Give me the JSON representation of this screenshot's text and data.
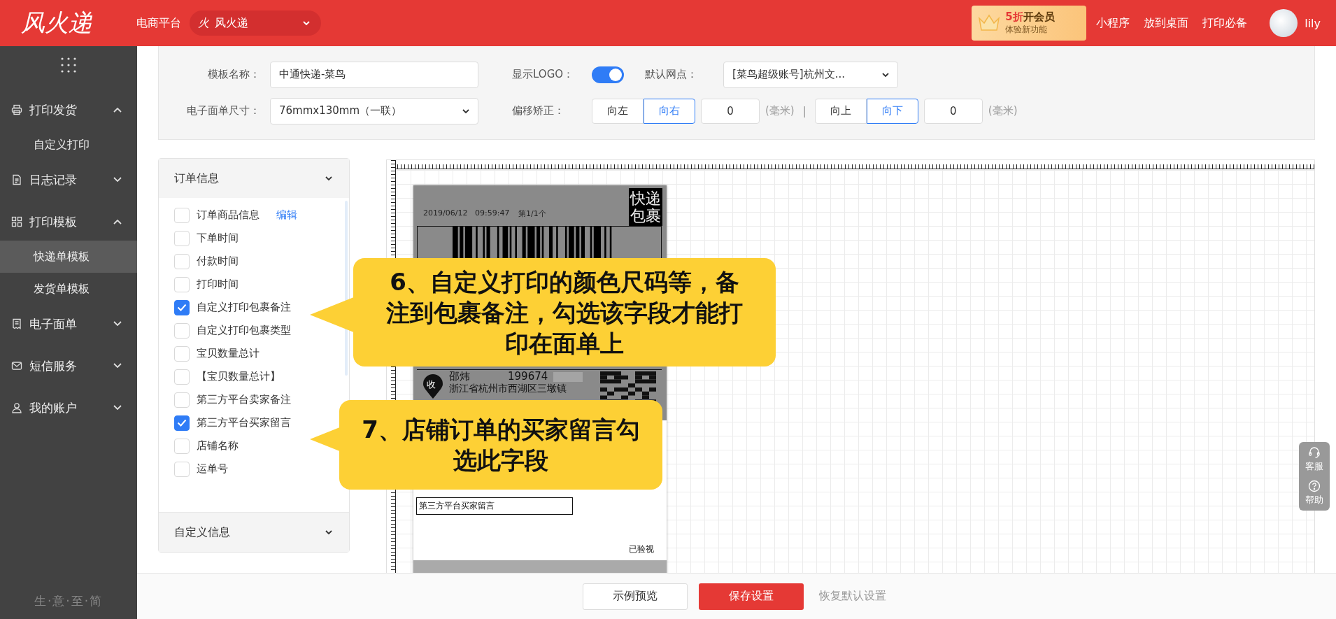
{
  "header": {
    "logo": "风火递",
    "platform_label": "电商平台",
    "shop_select": {
      "icon_char": "火",
      "value": "风火递"
    },
    "promo": {
      "highlight": "5折",
      "title": "开会员",
      "subtitle": "体验新功能"
    },
    "links": [
      "小程序",
      "放到桌面",
      "打印必备"
    ],
    "user": {
      "name": "lily"
    }
  },
  "sidebar": {
    "items": [
      {
        "label": "打印发货",
        "kind": "print",
        "expanded": true,
        "children": [
          {
            "label": "自定义打印",
            "selected": false
          }
        ]
      },
      {
        "label": "日志记录",
        "kind": "log",
        "expanded": false
      },
      {
        "label": "打印模板",
        "kind": "template",
        "expanded": true,
        "children": [
          {
            "label": "快递单模板",
            "selected": true
          },
          {
            "label": "发货单模板",
            "selected": false
          }
        ]
      },
      {
        "label": "电子面单",
        "kind": "waybill",
        "expanded": false
      },
      {
        "label": "短信服务",
        "kind": "sms",
        "expanded": false
      },
      {
        "label": "我的账户",
        "kind": "account",
        "expanded": false
      }
    ],
    "footer": "生·意·至·简"
  },
  "template_form": {
    "name_label": "模板名称：",
    "name_value": "中通快递-菜鸟",
    "logo_label": "显示LOGO：",
    "logo": {
      "on": true
    },
    "outlet_label": "默认网点：",
    "outlet_value": "[菜鸟超级账号]杭州文...",
    "size_label": "电子面单尺寸：",
    "size_value": "76mmx130mm（一联）",
    "offset_label": "偏移矫正：",
    "horizontal": {
      "options": [
        {
          "label": "向左",
          "selected": false
        },
        {
          "label": "向右",
          "selected": true
        }
      ],
      "value": "0",
      "unit": "(毫米)"
    },
    "separator": "|",
    "vertical": {
      "options": [
        {
          "label": "向上",
          "selected": false
        },
        {
          "label": "向下",
          "selected": true
        }
      ],
      "value": "0",
      "unit": "(毫米)"
    }
  },
  "field_panel": {
    "sections": [
      {
        "title": "订单信息",
        "fields": [
          {
            "label": "订单商品信息",
            "checked": false,
            "action": "编辑"
          },
          {
            "label": "下单时间",
            "checked": false
          },
          {
            "label": "付款时间",
            "checked": false
          },
          {
            "label": "打印时间",
            "checked": false
          },
          {
            "label": "自定义打印包裹备注",
            "checked": true
          },
          {
            "label": "自定义打印包裹类型",
            "checked": false
          },
          {
            "label": "宝贝数量总计",
            "checked": false
          },
          {
            "label": "【宝贝数量总计】",
            "checked": false
          },
          {
            "label": "第三方平台卖家备注",
            "checked": false
          },
          {
            "label": "第三方平台买家留言",
            "checked": true
          },
          {
            "label": "店铺名称",
            "checked": false
          },
          {
            "label": "运单号",
            "checked": false
          }
        ]
      },
      {
        "title": "自定义信息"
      }
    ]
  },
  "label_preview": {
    "date": "2019/06/12",
    "time": "09:59:47",
    "count": "第1/1个",
    "badge": "快递包裹",
    "pin_char": "收",
    "recipient_name": "邵炜",
    "recipient_phone": "199674",
    "recipient_address": "浙江省杭州市西湖区三墩镇",
    "buyer_message_box": "第三方平台买家留言",
    "inspected": "已验视"
  },
  "callouts": [
    {
      "text": "6、自定义打印的颜色尺码等，备注到包裹备注，勾选该字段才能打印在面单上"
    },
    {
      "text": "7、店铺订单的买家留言勾选此字段"
    }
  ],
  "float_widget": [
    {
      "kind": "support",
      "label": "客服"
    },
    {
      "kind": "help",
      "label": "帮助"
    }
  ],
  "footer_bar": {
    "buttons": [
      {
        "label": "示例预览",
        "kind": "default"
      },
      {
        "label": "保存设置",
        "kind": "primary"
      },
      {
        "label": "恢复默认设置",
        "kind": "link"
      }
    ]
  }
}
